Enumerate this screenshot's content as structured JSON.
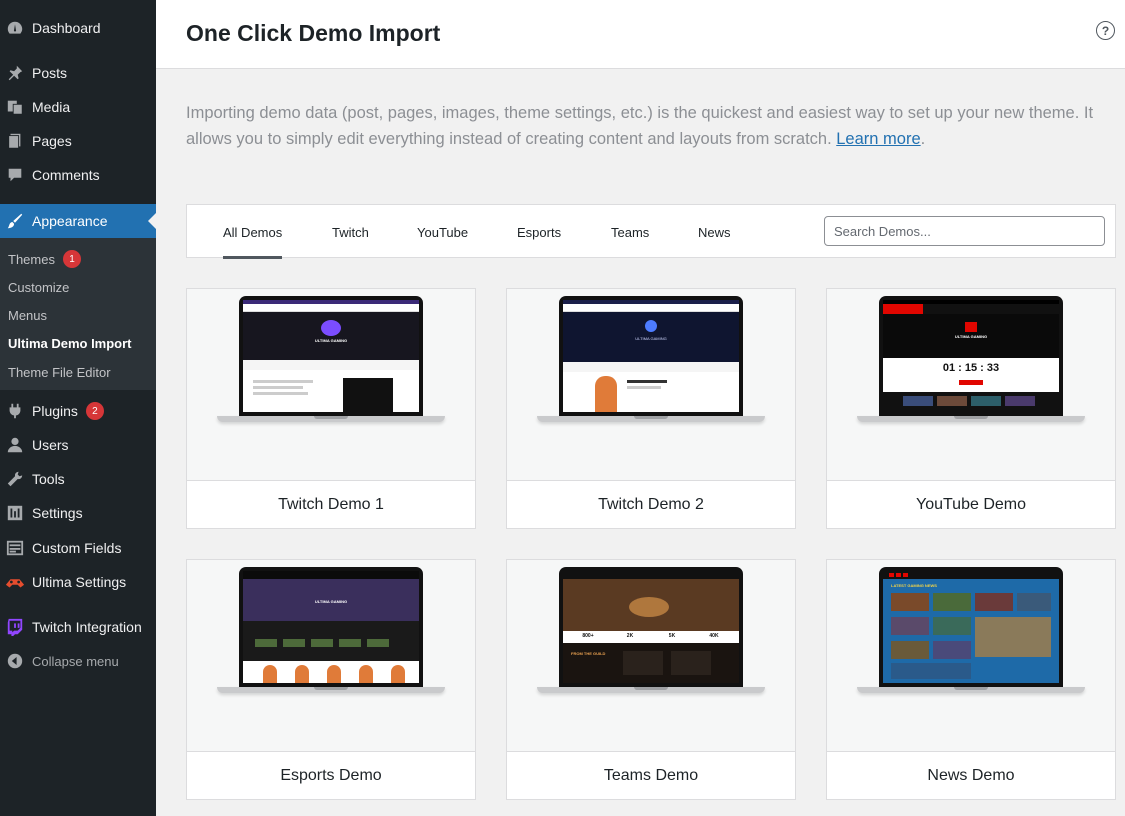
{
  "sidebar": {
    "items": [
      {
        "label": "Dashboard",
        "icon": "dashboard-icon"
      },
      {
        "label": "Posts",
        "icon": "pin-icon"
      },
      {
        "label": "Media",
        "icon": "media-icon"
      },
      {
        "label": "Pages",
        "icon": "pages-icon"
      },
      {
        "label": "Comments",
        "icon": "comment-icon"
      },
      {
        "label": "Appearance",
        "icon": "brush-icon"
      },
      {
        "label": "Plugins",
        "icon": "plug-icon",
        "badge": "2"
      },
      {
        "label": "Users",
        "icon": "user-icon"
      },
      {
        "label": "Tools",
        "icon": "wrench-icon"
      },
      {
        "label": "Settings",
        "icon": "settings-icon"
      },
      {
        "label": "Custom Fields",
        "icon": "fields-icon"
      },
      {
        "label": "Ultima Settings",
        "icon": "ultima-icon"
      },
      {
        "label": "Twitch Integration",
        "icon": "twitch-icon"
      },
      {
        "label": "Collapse menu",
        "icon": "collapse-icon"
      }
    ],
    "submenu": [
      {
        "label": "Themes",
        "badge": "1"
      },
      {
        "label": "Customize"
      },
      {
        "label": "Menus"
      },
      {
        "label": "Ultima Demo Import"
      },
      {
        "label": "Theme File Editor"
      }
    ]
  },
  "header": {
    "title": "One Click Demo Import",
    "help": "?"
  },
  "intro": {
    "text": "Importing demo data (post, pages, images, theme settings, etc.) is the quickest and easiest way to set up your new theme. It allows you to simply edit everything instead of creating content and layouts from scratch. ",
    "link": "Learn more",
    "end": "."
  },
  "filters": {
    "tabs": [
      "All Demos",
      "Twitch",
      "YouTube",
      "Esports",
      "Teams",
      "News"
    ],
    "search_placeholder": "Search Demos..."
  },
  "demos": [
    {
      "name": "Twitch Demo 1"
    },
    {
      "name": "Twitch Demo 2"
    },
    {
      "name": "YouTube Demo"
    },
    {
      "name": "Esports Demo"
    },
    {
      "name": "Teams Demo"
    },
    {
      "name": "News Demo"
    }
  ],
  "previews": {
    "t1_brand": "ULTIMA GAMING",
    "t2_brand": "ULTIMA GAMING",
    "yt_brand": "ULTIMA GAMING",
    "yt_countdown": "01 : 15 : 33",
    "es_brand": "ULTIMA GAMING",
    "teams_heading": "FROM THE GUILD",
    "teams_stats": [
      "800+",
      "2K",
      "5K",
      "40K"
    ],
    "news_heading": "LATEST GAMING NEWS"
  },
  "colors": {
    "accent": "#2271b1",
    "sidebar": "#1d2327",
    "badge": "#d63638"
  }
}
